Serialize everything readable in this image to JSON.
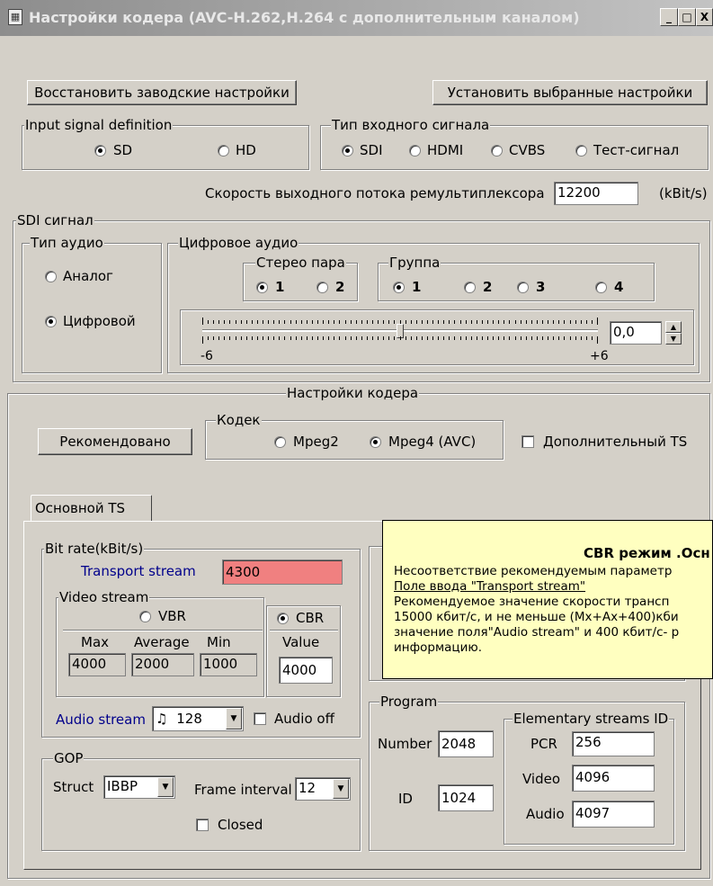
{
  "window": {
    "title": "Настройки кодера (AVC-H.262,H.264 с дополнительным каналом)",
    "controls": {
      "minimize": "_",
      "maximize": "□",
      "close": "X"
    }
  },
  "toolbar": {
    "restore_label": "Восстановить заводские настройки",
    "apply_label": "Установить выбранные настройки"
  },
  "input_definition": {
    "title": "Input signal definition",
    "options": [
      "SD",
      "HD"
    ],
    "selected": "SD"
  },
  "input_type": {
    "title": "Тип входного сигнала",
    "options": [
      "SDI",
      "HDMI",
      "CVBS",
      "Тест-сигнал"
    ],
    "selected": "SDI"
  },
  "remux": {
    "label": "Скорость выходного потока ремультиплексора",
    "value": "12200",
    "unit": "(kBit/s)"
  },
  "sdi": {
    "title": "SDI сигнал",
    "audio_type": {
      "title": "Тип аудио",
      "options": [
        "Аналог",
        "Цифровой"
      ],
      "selected": "Цифровой"
    },
    "digital": {
      "title": "Цифровое аудио",
      "stereo_pair": {
        "title": "Стерео пара",
        "options": [
          "1",
          "2"
        ],
        "selected": "1"
      },
      "group": {
        "title": "Группа",
        "options": [
          "1",
          "2",
          "3",
          "4"
        ],
        "selected": "1"
      },
      "slider": {
        "min_label": "-6",
        "max_label": "+6",
        "position": 0.5
      },
      "spin_value": "0,0"
    }
  },
  "encoder": {
    "title": "Настройки кодера",
    "recommended_label": "Рекомендовано",
    "codec": {
      "title": "Кодек",
      "options": [
        "Mpeg2",
        "Mpeg4 (AVC)"
      ],
      "selected": "Mpeg4 (AVC)"
    },
    "extra_ts_label": "Дополнительный TS",
    "tab_label": "Основной TS"
  },
  "bitrate": {
    "title": "Bit rate(kBit/s)",
    "transport_label": "Transport stream",
    "transport_value": "4300",
    "transport_error_color": "#f08080",
    "video": {
      "title": "Video stream",
      "vbr_label": "VBR",
      "cbr_label": "CBR",
      "selected": "CBR",
      "headers": [
        "Max",
        "Average",
        "Min",
        "Value"
      ],
      "values": [
        "4000",
        "2000",
        "1000",
        "4000"
      ]
    },
    "audio_label": "Audio stream",
    "audio_value": "128",
    "audio_icon": "music-note-icon",
    "audio_off_label": "Audio off"
  },
  "gop": {
    "title": "GOP",
    "struct_label": "Struct",
    "struct_value": "IBBP",
    "frame_interval_label": "Frame interval",
    "frame_interval_value": "12",
    "closed_label": "Closed"
  },
  "program": {
    "title": "Program",
    "number_label": "Number",
    "number_value": "2048",
    "id_label": "ID",
    "id_value": "1024",
    "es": {
      "title": "Elementary streams ID",
      "pcr_label": "PCR",
      "pcr_value": "256",
      "video_label": "Video",
      "video_value": "4096",
      "audio_label": "Audio",
      "audio_value": "4097"
    }
  },
  "tooltip": {
    "title": "CBR режим .Осн",
    "lines": [
      "Несоответствие  рекомендуемым параметр",
      "Поле ввода \"Transport stream\"",
      " Рекомендуемое значение скорости трансп",
      "15000 кбит/с,  и не меньше (Mx+Ax+400)кби",
      "значение поля\"Audio stream\"  и 400 кбит/с- р",
      "информацию."
    ]
  }
}
